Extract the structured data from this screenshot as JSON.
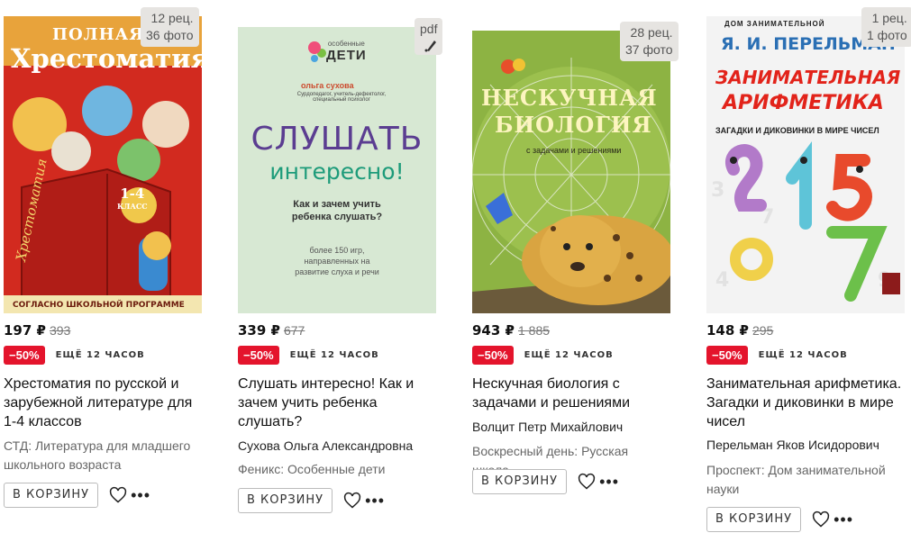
{
  "products": [
    {
      "badge": [
        "12 рец.",
        "36 фото"
      ],
      "cover": {
        "top": "ПОЛНАЯ",
        "title": "Хрестоматия",
        "grade": "1-4",
        "grade_sub": "КЛАСС",
        "spine": "Хрестоматия",
        "bottom": "СОГЛАСНО ШКОЛЬНОЙ ПРОГРАММЕ"
      },
      "price": "197 ₽",
      "old_price": "393",
      "discount": "−50%",
      "timer": "ЕЩЁ 12 ЧАСОВ",
      "title": "Хрестоматия по русской и зарубежной литературе для 1-4 классов",
      "author": "",
      "publisher": "СТД: Литература для младшего школьного возраста",
      "cart": "В КОРЗИНУ"
    },
    {
      "badge": [
        "pdf"
      ],
      "cover": {
        "logo_top": "особенные",
        "logo": "ДЕТИ",
        "author": "ольга сухова",
        "role": "Сурдопедагог, учитель-дефектолог, специальный психолог",
        "title1": "СЛУШАТЬ",
        "title2": "интересно!",
        "sub": "Как и зачем учить ребенка слушать?",
        "note": "более 150 игр, направленных на развитие слуха и речи"
      },
      "price": "339 ₽",
      "old_price": "677",
      "discount": "−50%",
      "timer": "ЕЩЁ 12 ЧАСОВ",
      "title": "Слушать интересно! Как и зачем учить ребенка слушать?",
      "author": "Сухова Ольга Александровна",
      "publisher": "Феникс: Особенные дети",
      "cart": "В КОРЗИНУ"
    },
    {
      "badge": [
        "28 рец.",
        "37 фото"
      ],
      "cover": {
        "top": "НЕСКУ... УЧАЯ",
        "title1": "НЕСКУЧНАЯ",
        "title2": "БИОЛОГИЯ",
        "sub": "с задачами и решениями"
      },
      "price": "943 ₽",
      "old_price": "1 885",
      "discount": "−50%",
      "timer": "ЕЩЁ 12 ЧАСОВ",
      "title": "Нескучная биология с задачами и решениями",
      "author": "Волцит Петр Михайлович",
      "publisher": "Воскресный день: Русская школа",
      "cart": "В КОРЗИНУ"
    },
    {
      "badge": [
        "1 рец.",
        "1 фото"
      ],
      "cover": {
        "top": "ДОМ ЗАНИМАТЕЛЬНОЙ",
        "author": "Я. И. ПЕРЕЛЬМАН",
        "title1": "ЗАНИМАТЕЛЬНАЯ",
        "title2": "АРИФМЕТИКА",
        "sub": "ЗАГАДКИ И ДИКОВИНКИ В МИРЕ ЧИСЕЛ"
      },
      "price": "148 ₽",
      "old_price": "295",
      "discount": "−50%",
      "timer": "ЕЩЁ 12 ЧАСОВ",
      "title": "Занимательная арифметика. Загадки и диковинки в мире чисел",
      "author": "Перельман Яков Исидорович",
      "publisher": "Проспект: Дом занимательной науки",
      "cart": "В КОРЗИНУ"
    }
  ]
}
